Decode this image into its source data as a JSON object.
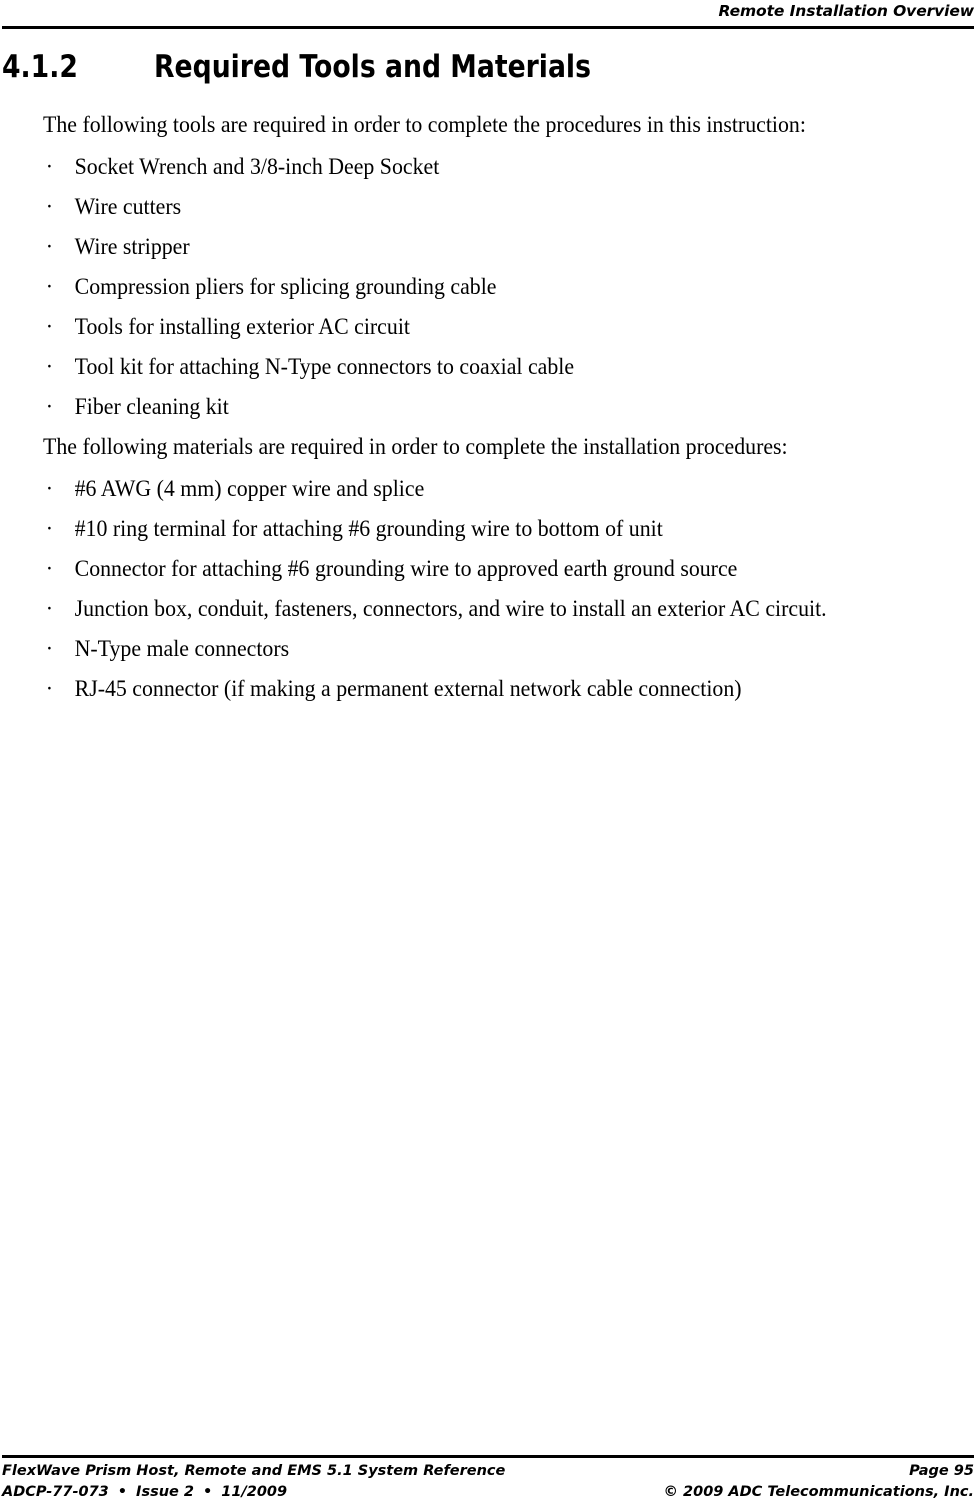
{
  "header": {
    "running_title": "Remote Installation Overview"
  },
  "section": {
    "number": "4.1.2",
    "title": "Required Tools and Materials"
  },
  "body": {
    "tools_intro": "The following tools are required in order to complete the procedures in this instruction:",
    "tools": [
      "Socket Wrench and 3/8-inch Deep Socket",
      "Wire cutters",
      "Wire stripper",
      "Compression pliers for splicing grounding cable",
      "Tools for installing exterior AC circuit",
      "Tool kit for attaching N-Type connectors to coaxial cable",
      "Fiber cleaning kit"
    ],
    "materials_intro": "The following materials are required in order to complete the installation procedures:",
    "materials": [
      "#6 AWG (4 mm) copper wire and splice",
      "#10 ring terminal for attaching #6 grounding wire to bottom of unit",
      "Connector for attaching #6 grounding wire to approved earth ground source",
      "Junction box, conduit, fasteners, connectors, and wire to install an exterior AC circuit.",
      "N-Type male connectors",
      "RJ-45 connector (if making a permanent external network cable connection)"
    ],
    "bullet_glyph": "·"
  },
  "footer": {
    "document_title": "FlexWave Prism Host, Remote and EMS 5.1 System Reference",
    "page_label": "Page 95",
    "doc_number": "ADCP-77-073",
    "issue": "Issue 2",
    "date": "11/2009",
    "separator": "•",
    "copyright": "© 2009 ADC Telecommunications, Inc."
  }
}
